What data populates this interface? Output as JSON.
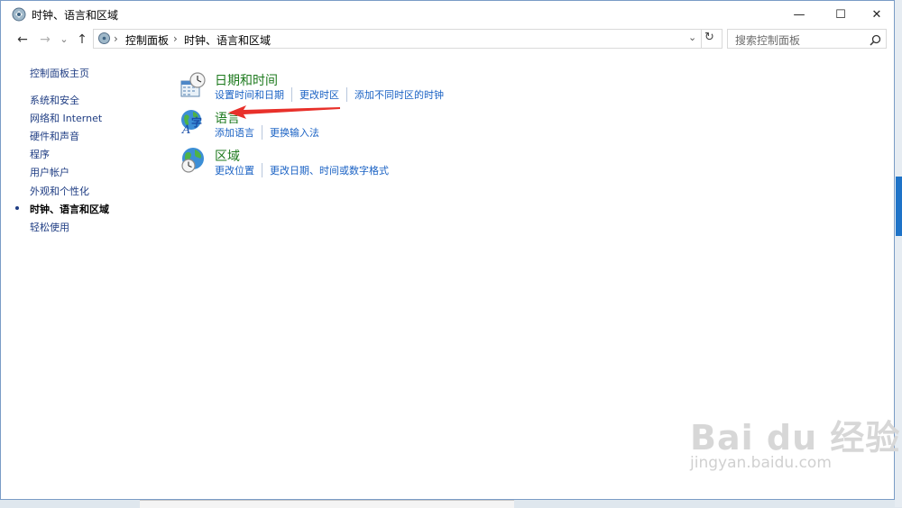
{
  "window": {
    "title": "时钟、语言和区域"
  },
  "controls": {
    "minimize": "—",
    "maximize": "☐",
    "close": "✕"
  },
  "nav": {
    "back": "←",
    "forward": "→",
    "recent": "⌄",
    "up": "↑"
  },
  "address": {
    "path": [
      "控制面板",
      "时钟、语言和区域"
    ],
    "separator": "›"
  },
  "search": {
    "placeholder": "搜索控制面板"
  },
  "sidebar": {
    "items": [
      {
        "label": "控制面板主页",
        "active": false
      },
      {
        "label": "系统和安全",
        "active": false
      },
      {
        "label": "网络和 Internet",
        "active": false
      },
      {
        "label": "硬件和声音",
        "active": false
      },
      {
        "label": "程序",
        "active": false
      },
      {
        "label": "用户帐户",
        "active": false
      },
      {
        "label": "外观和个性化",
        "active": false
      },
      {
        "label": "时钟、语言和区域",
        "active": true
      },
      {
        "label": "轻松使用",
        "active": false
      }
    ]
  },
  "categories": [
    {
      "title": "日期和时间",
      "icon": "clock-calendar-icon",
      "links": [
        "设置时间和日期",
        "更改时区",
        "添加不同时区的时钟"
      ]
    },
    {
      "title": "语言",
      "icon": "language-globe-icon",
      "links": [
        "添加语言",
        "更换输入法"
      ]
    },
    {
      "title": "区域",
      "icon": "region-globe-icon",
      "links": [
        "更改位置",
        "更改日期、时间或数字格式"
      ]
    }
  ],
  "colors": {
    "category_title": "#1e7a1e",
    "link": "#1a62c4",
    "sidebar_link": "#1f3d83",
    "annotation_arrow": "#e8302a"
  },
  "watermark": {
    "brand": "Bai du 经验",
    "url": "jingyan.baidu.com"
  }
}
